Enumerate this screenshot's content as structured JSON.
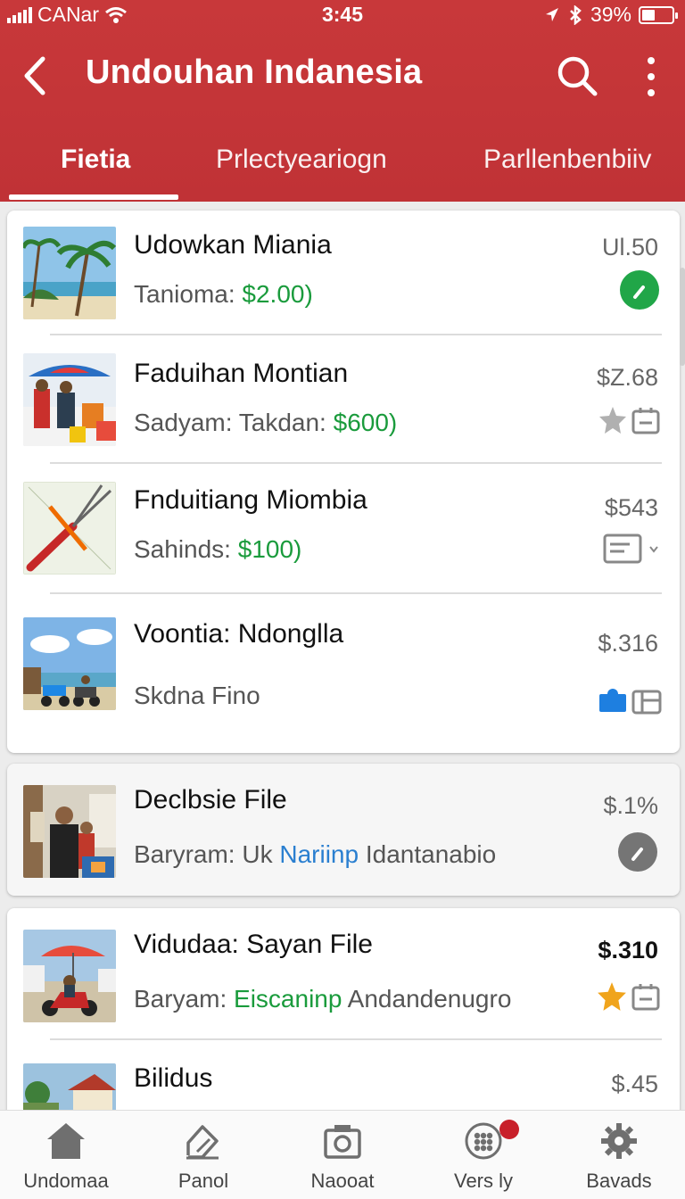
{
  "status_bar": {
    "carrier": "CANar",
    "time": "3:45",
    "battery": "39%"
  },
  "app_bar": {
    "title": "Undouhan Indanesia",
    "back_icon": "chevron-left-icon",
    "search_icon": "search-icon",
    "more_icon": "more-vertical-icon"
  },
  "tabs": [
    {
      "label": "Fietia",
      "active": true
    },
    {
      "label": "Prlectyeariogn",
      "active": false
    },
    {
      "label": "Parllenbenbiiv",
      "active": false
    }
  ],
  "cards": [
    {
      "items": [
        {
          "title": "Udowkan Miania",
          "sub_prefix": "Tanioma: ",
          "sub_highlight": "$2.00)",
          "sub_suffix": "",
          "price": "Ul.50",
          "icon": "green-arrow-circle-icon"
        },
        {
          "title": "Faduihan Montian",
          "sub_prefix": "Sadyam: Takdan: ",
          "sub_highlight": "$600)",
          "sub_suffix": "",
          "price": "$Z.68",
          "icon": "star-and-calendar-icon"
        },
        {
          "title": "Fnduitiang Miombia",
          "sub_prefix": "Sahinds: ",
          "sub_highlight": "$100)",
          "sub_suffix": "",
          "price": "$543",
          "icon": "card-icon"
        },
        {
          "title": "Voontia: Ndonglla",
          "sub_prefix": "Skdna Fino",
          "sub_highlight": "",
          "sub_suffix": "",
          "price": "$.316",
          "icon": "blue-tag-and-card-icon"
        }
      ]
    },
    {
      "items": [
        {
          "title": "Declbsie File",
          "sub_prefix": "Baryram: Uk ",
          "sub_highlight": "Nariinp",
          "sub_suffix": " Idantanabio",
          "price": "$.1%",
          "icon": "gray-arrow-circle-icon"
        }
      ]
    },
    {
      "items": [
        {
          "title": "Vidudaa: Sayan File",
          "sub_prefix": "Baryam: ",
          "sub_highlight": "Eiscaninp",
          "sub_suffix": " Andandenugro",
          "price": "$.310",
          "icon": "gold-star-and-calendar-icon"
        },
        {
          "title": "Bilidus",
          "sub_prefix": "",
          "sub_highlight": "",
          "sub_suffix": "",
          "price": "$.45",
          "icon": ""
        }
      ]
    }
  ],
  "bottom_nav": [
    {
      "label": "Undomaa",
      "icon": "home-icon"
    },
    {
      "label": "Panol",
      "icon": "edit-icon"
    },
    {
      "label": "Naooat",
      "icon": "camera-icon"
    },
    {
      "label": "Vers ly",
      "icon": "apps-icon",
      "badge": true
    },
    {
      "label": "Bavads",
      "icon": "settings-icon"
    }
  ],
  "colors": {
    "brand_red": "#c8383a",
    "highlight_green": "#1a9b3c",
    "highlight_blue": "#2a7fd0",
    "badge_red": "#c8202a"
  }
}
